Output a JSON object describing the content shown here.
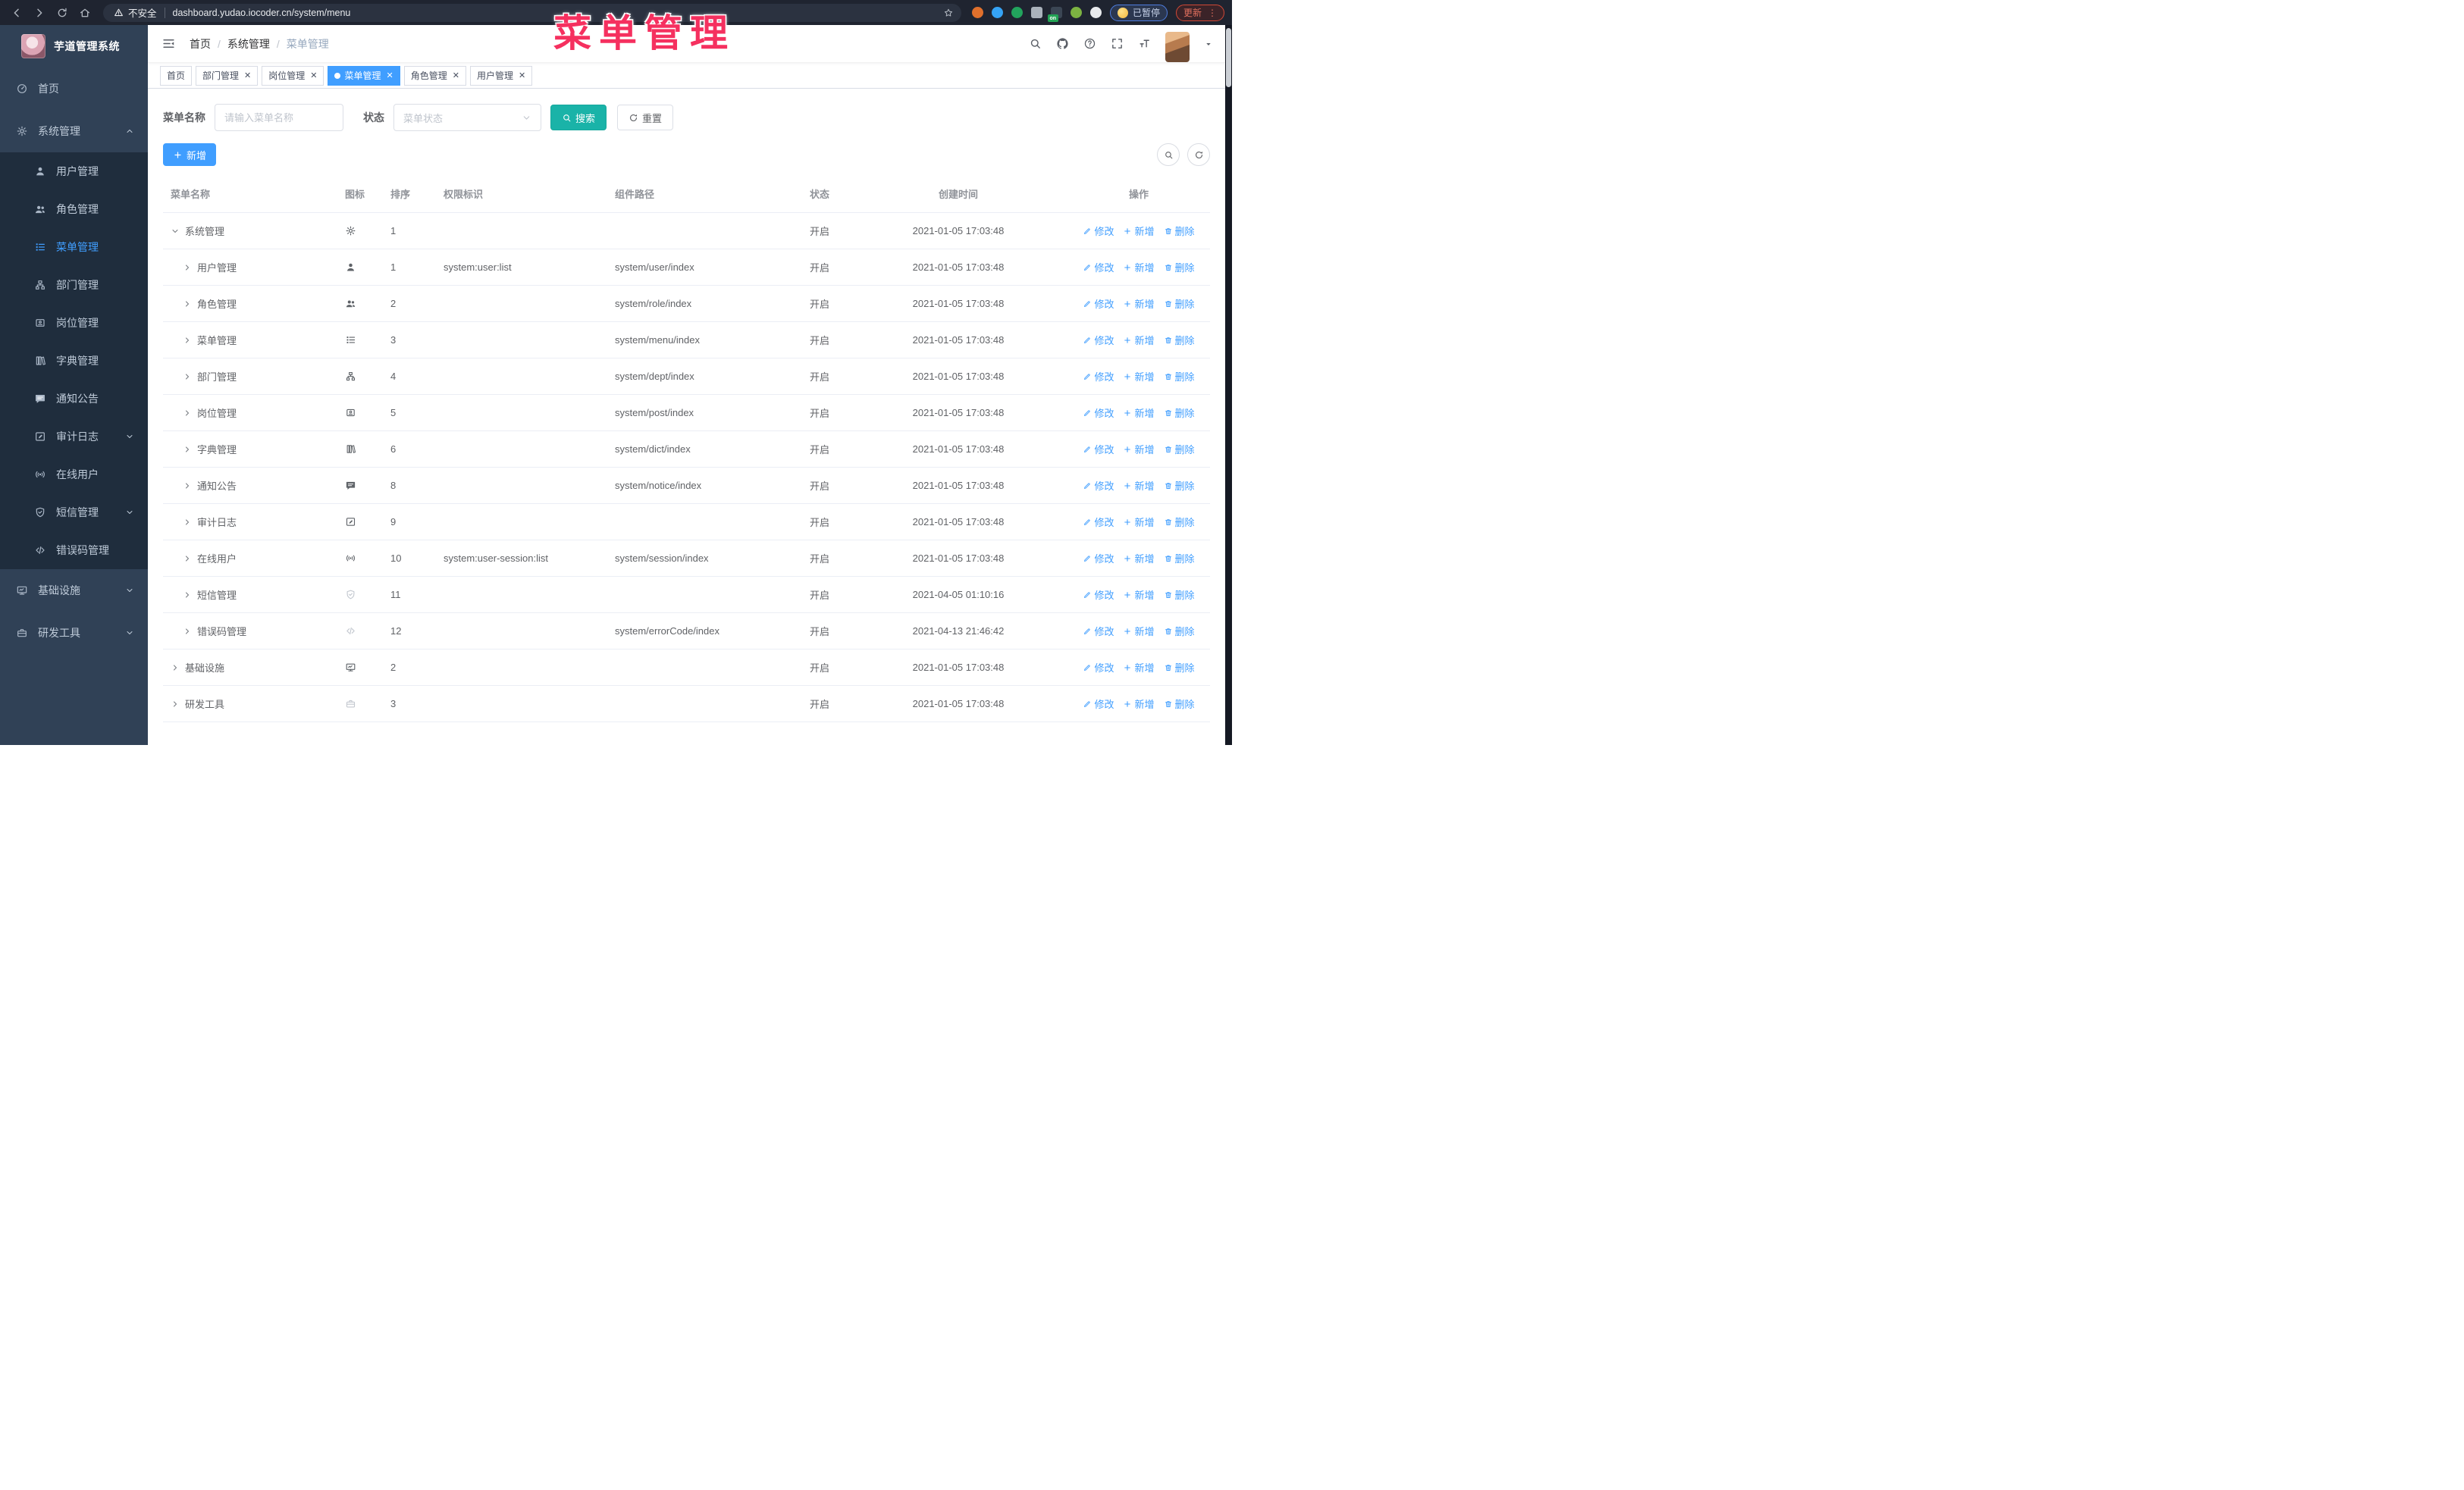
{
  "browser": {
    "nav_icons": [
      "back",
      "forward",
      "reload",
      "home"
    ],
    "security_label": "不安全",
    "url": "dashboard.yudao.iocoder.cn/system/menu",
    "extensions": [
      {
        "key": "extension-ring",
        "color": "#e0702c"
      },
      {
        "key": "extension-gem",
        "color": "#35a3f5"
      },
      {
        "key": "extension-check",
        "color": "#22a45d"
      },
      {
        "key": "extension-grid",
        "color": "#aab2bb"
      },
      {
        "key": "extension-server",
        "color": "#3b4654",
        "badge": "on"
      },
      {
        "key": "extension-leaf",
        "color": "#7cb342"
      },
      {
        "key": "extension-puzzle",
        "color": "#e8eaed"
      }
    ],
    "paused_label": "已暂停",
    "update_label": "更新",
    "more_dots": "⋮"
  },
  "overlay_title": "菜单管理",
  "sidebar": {
    "title": "芋道管理系统",
    "items": [
      {
        "key": "home",
        "label": "首页",
        "icon": "dashboard"
      },
      {
        "key": "system-management",
        "label": "系统管理",
        "icon": "gear",
        "arrow": "up",
        "children": [
          {
            "key": "user-management",
            "label": "用户管理",
            "icon": "user"
          },
          {
            "key": "role-management",
            "label": "角色管理",
            "icon": "users"
          },
          {
            "key": "menu-management",
            "label": "菜单管理",
            "icon": "menu",
            "active": true
          },
          {
            "key": "dept-management",
            "label": "部门管理",
            "icon": "tree"
          },
          {
            "key": "post-management",
            "label": "岗位管理",
            "icon": "badge"
          },
          {
            "key": "dict-management",
            "label": "字典管理",
            "icon": "dict"
          },
          {
            "key": "notice-announcement",
            "label": "通知公告",
            "icon": "message"
          },
          {
            "key": "audit-log",
            "label": "审计日志",
            "icon": "log",
            "arrow": "down"
          },
          {
            "key": "online-users",
            "label": "在线用户",
            "icon": "online"
          },
          {
            "key": "sms-management",
            "label": "短信管理",
            "icon": "shield",
            "arrow": "down"
          },
          {
            "key": "error-code-management",
            "label": "错误码管理",
            "icon": "code"
          }
        ]
      },
      {
        "key": "infrastructure",
        "label": "基础设施",
        "icon": "monitor",
        "arrow": "down"
      },
      {
        "key": "dev-tools",
        "label": "研发工具",
        "icon": "tool",
        "arrow": "down"
      }
    ]
  },
  "navbar": {
    "breadcrumb": [
      {
        "key": "home",
        "label": "首页"
      },
      {
        "key": "system-management",
        "label": "系统管理"
      },
      {
        "key": "menu-management",
        "label": "菜单管理"
      }
    ],
    "icons": [
      "search",
      "github",
      "question",
      "fullscreen",
      "textsize"
    ]
  },
  "tags": [
    {
      "key": "home",
      "label": "首页",
      "closable": false,
      "active": false
    },
    {
      "key": "dept-management",
      "label": "部门管理",
      "closable": true,
      "active": false
    },
    {
      "key": "post-management",
      "label": "岗位管理",
      "closable": true,
      "active": false
    },
    {
      "key": "menu-management",
      "label": "菜单管理",
      "closable": true,
      "active": true
    },
    {
      "key": "role-management",
      "label": "角色管理",
      "closable": true,
      "active": false
    },
    {
      "key": "user-management",
      "label": "用户管理",
      "closable": true,
      "active": false
    }
  ],
  "filter": {
    "name_label": "菜单名称",
    "name_placeholder": "请输入菜单名称",
    "name_value": "",
    "status_label": "状态",
    "status_placeholder": "菜单状态",
    "search_label": "搜索",
    "reset_label": "重置",
    "add_label": "新增"
  },
  "table": {
    "headers": [
      "菜单名称",
      "图标",
      "排序",
      "权限标识",
      "组件路径",
      "状态",
      "创建时间",
      "操作"
    ],
    "actions": {
      "edit": "修改",
      "add": "新增",
      "delete": "删除"
    },
    "rows": [
      {
        "name": "系统管理",
        "icon": "gear",
        "level": 0,
        "expanded": true,
        "order": "1",
        "perm": "",
        "path": "",
        "status": "开启",
        "time": "2021-01-05 17:03:48"
      },
      {
        "name": "用户管理",
        "icon": "user",
        "level": 1,
        "expanded": false,
        "order": "1",
        "perm": "system:user:list",
        "path": "system/user/index",
        "status": "开启",
        "time": "2021-01-05 17:03:48"
      },
      {
        "name": "角色管理",
        "icon": "users",
        "level": 1,
        "expanded": false,
        "order": "2",
        "perm": "",
        "path": "system/role/index",
        "status": "开启",
        "time": "2021-01-05 17:03:48"
      },
      {
        "name": "菜单管理",
        "icon": "menu",
        "level": 1,
        "expanded": false,
        "order": "3",
        "perm": "",
        "path": "system/menu/index",
        "status": "开启",
        "time": "2021-01-05 17:03:48"
      },
      {
        "name": "部门管理",
        "icon": "tree",
        "level": 1,
        "expanded": false,
        "order": "4",
        "perm": "",
        "path": "system/dept/index",
        "status": "开启",
        "time": "2021-01-05 17:03:48"
      },
      {
        "name": "岗位管理",
        "icon": "badge",
        "level": 1,
        "expanded": false,
        "order": "5",
        "perm": "",
        "path": "system/post/index",
        "status": "开启",
        "time": "2021-01-05 17:03:48"
      },
      {
        "name": "字典管理",
        "icon": "dict",
        "level": 1,
        "expanded": false,
        "order": "6",
        "perm": "",
        "path": "system/dict/index",
        "status": "开启",
        "time": "2021-01-05 17:03:48"
      },
      {
        "name": "通知公告",
        "icon": "message",
        "level": 1,
        "expanded": false,
        "order": "8",
        "perm": "",
        "path": "system/notice/index",
        "status": "开启",
        "time": "2021-01-05 17:03:48"
      },
      {
        "name": "审计日志",
        "icon": "log",
        "level": 1,
        "expanded": false,
        "order": "9",
        "perm": "",
        "path": "",
        "status": "开启",
        "time": "2021-01-05 17:03:48"
      },
      {
        "name": "在线用户",
        "icon": "online",
        "level": 1,
        "expanded": false,
        "order": "10",
        "perm": "system:user-session:list",
        "path": "system/session/index",
        "status": "开启",
        "time": "2021-01-05 17:03:48"
      },
      {
        "name": "短信管理",
        "icon": "shield",
        "level": 1,
        "expanded": false,
        "order": "11",
        "perm": "",
        "path": "",
        "status": "开启",
        "time": "2021-04-05 01:10:16",
        "icon_muted": true
      },
      {
        "name": "错误码管理",
        "icon": "code",
        "level": 1,
        "expanded": false,
        "order": "12",
        "perm": "",
        "path": "system/errorCode/index",
        "status": "开启",
        "time": "2021-04-13 21:46:42",
        "icon_muted": true
      },
      {
        "name": "基础设施",
        "icon": "monitor",
        "level": 0,
        "expanded": false,
        "order": "2",
        "perm": "",
        "path": "",
        "status": "开启",
        "time": "2021-01-05 17:03:48"
      },
      {
        "name": "研发工具",
        "icon": "tool",
        "level": 0,
        "expanded": false,
        "order": "3",
        "perm": "",
        "path": "",
        "status": "开启",
        "time": "2021-01-05 17:03:48",
        "icon_muted": true
      }
    ]
  }
}
